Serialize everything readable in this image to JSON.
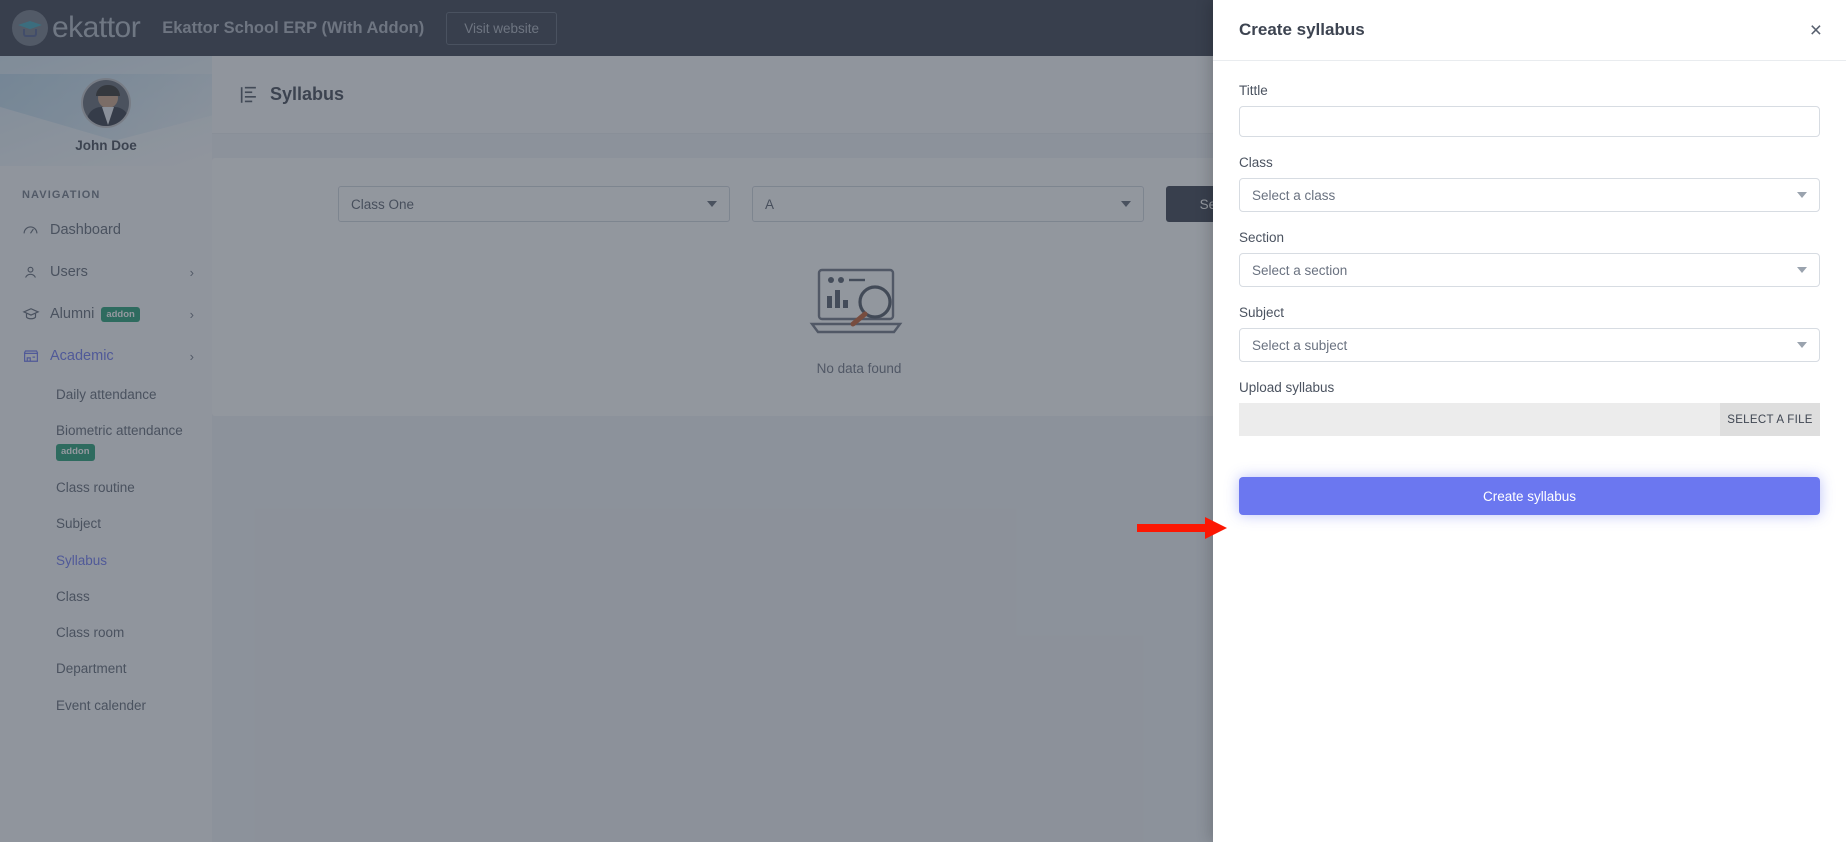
{
  "topbar": {
    "brand_word": "ekattor",
    "app_title": "Ekattor School ERP (With Addon)",
    "visit_website_label": "Visit website"
  },
  "sidebar": {
    "profile_name": "John Doe",
    "nav_heading": "NAVIGATION",
    "items": [
      {
        "label": "Dashboard",
        "icon": "speedometer-icon",
        "has_chevron": false,
        "badge": ""
      },
      {
        "label": "Users",
        "icon": "user-icon",
        "has_chevron": true,
        "badge": ""
      },
      {
        "label": "Alumni",
        "icon": "graduation-cap-icon",
        "has_chevron": true,
        "badge": "addon"
      },
      {
        "label": "Academic",
        "icon": "store-icon",
        "has_chevron": true,
        "badge": "",
        "active": true
      }
    ],
    "academic_submenu": [
      {
        "label": "Daily attendance",
        "badge": ""
      },
      {
        "label": "Biometric attendance",
        "badge": "addon"
      },
      {
        "label": "Class routine",
        "badge": ""
      },
      {
        "label": "Subject",
        "badge": ""
      },
      {
        "label": "Syllabus",
        "badge": "",
        "active": true
      },
      {
        "label": "Class",
        "badge": ""
      },
      {
        "label": "Class room",
        "badge": ""
      },
      {
        "label": "Department",
        "badge": ""
      },
      {
        "label": "Event calender",
        "badge": ""
      }
    ]
  },
  "main": {
    "page_title": "Syllabus",
    "filters": {
      "class_value": "Class One",
      "section_value": "A",
      "search_label": "Search"
    },
    "empty_state_label": "No data found"
  },
  "panel": {
    "title": "Create syllabus",
    "close_label": "×",
    "fields": {
      "title_label": "Tittle",
      "title_value": "",
      "title_placeholder": "",
      "class_label": "Class",
      "class_value": "Select a class",
      "section_label": "Section",
      "section_value": "Select a section",
      "subject_label": "Subject",
      "subject_value": "Select a subject",
      "upload_label": "Upload syllabus",
      "file_name_value": "",
      "select_file_label": "SELECT A FILE"
    },
    "submit_label": "Create syllabus"
  },
  "annotation": {
    "arrow_color": "#fc1703",
    "points_to": "create-syllabus-submit-button"
  },
  "colors": {
    "topbar_bg": "#343a49",
    "accent": "#6b77f0",
    "addon_badge": "#1d9b71",
    "overlay": "rgba(60,67,80,0.55)"
  }
}
